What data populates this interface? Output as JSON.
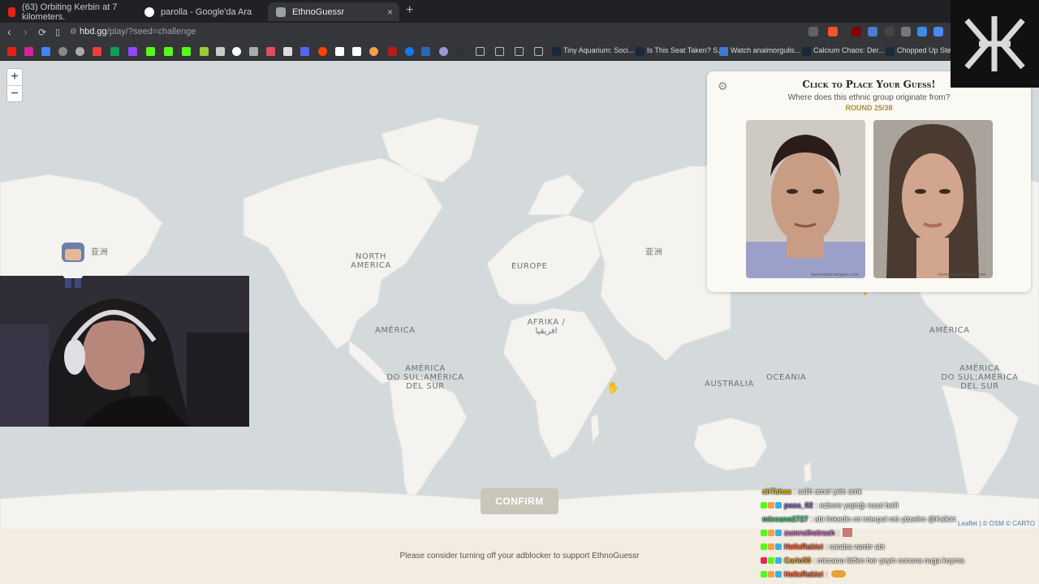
{
  "browser": {
    "tabs": [
      {
        "title": "(63) Orbiting Kerbin at 7 kilometers.",
        "favicon_color": "#e62117",
        "active": false
      },
      {
        "title": "parolla - Google'da Ara",
        "favicon_color": "#ffffff",
        "active": false
      },
      {
        "title": "EthnoGuessr",
        "favicon_color": "#9aa0a6",
        "active": true
      }
    ],
    "new_tab_symbol": "+",
    "close_symbol": "×",
    "url_host": "hbd.gg",
    "url_path": "/play/?seed=challenge",
    "bookmarks": [
      {
        "label": "Tiny Aquarium: Soci...",
        "icon_color": "#1b2838"
      },
      {
        "label": "Is This Seat Taken? S...",
        "icon_color": "#1b2838"
      },
      {
        "label": "Watch analmorgulis...",
        "icon_color": "#3d7bd6"
      },
      {
        "label": "Calcium Chaos: Der...",
        "icon_color": "#1b2838"
      },
      {
        "label": "Chopped Up Steam",
        "icon_color": "#1b2838"
      }
    ]
  },
  "map": {
    "labels": {
      "asia_left": "亚洲",
      "asia_right": "亚洲",
      "north_america": "NORTH\nAMERICA",
      "europe": "EUROPE",
      "africa": "AFRIKA /\nافريقيا",
      "america_left": "AMÉRICA",
      "america_right": "AMÉRICA",
      "south_america_left": "AMÉRICA\nDO SUL;AMÉRICA\nDEL SUR",
      "south_america_right": "AMÉRICA\nDO SUL;AMÉRICA\nDEL SUR",
      "australia": "AUSTRALIA",
      "oceania": "OCEANIA"
    },
    "zoom_in": "+",
    "zoom_out": "−",
    "attribution": "Leaflet | © OSM © CARTO"
  },
  "guess_panel": {
    "title": "Click to Place Your Guess!",
    "subtitle": "Where does this ethnic group originate from?",
    "round": "ROUND 25/38",
    "image_watermark": "humanphenotypes.com",
    "active_dot_color": "#d9a441",
    "inactive_dot_color": "#cfcfcf"
  },
  "confirm_label": "CONFIRM",
  "footer_message": "Please consider turning off your adblocker to support EthnoGuessr",
  "chat": [
    {
      "user": "ahTahaa",
      "color": "#f0c419",
      "text": ": salih amel çıktı amk"
    },
    {
      "user": "pasa_02",
      "color": "#8a6bd8",
      "text": ": ezbere yaptığı nasıl belli"
    },
    {
      "user": "miccano2727",
      "color": "#3ed17a",
      "text": ": abi linkedin mi interpol mü çözelim @Kalkirt"
    },
    {
      "user": "zumruthetrash",
      "color": "#e06cc7",
      "text": ":"
    },
    {
      "user": "HelixRakici",
      "color": "#ff6a3d",
      "text": ": caraba vardır abi"
    },
    {
      "user": "Carlo55",
      "color": "#e7a52f",
      "text": ": miccano lütfen her şeyin sonuna nuga koyma"
    },
    {
      "user": "HelixRakici",
      "color": "#ff6a3d",
      "text": ":"
    }
  ]
}
